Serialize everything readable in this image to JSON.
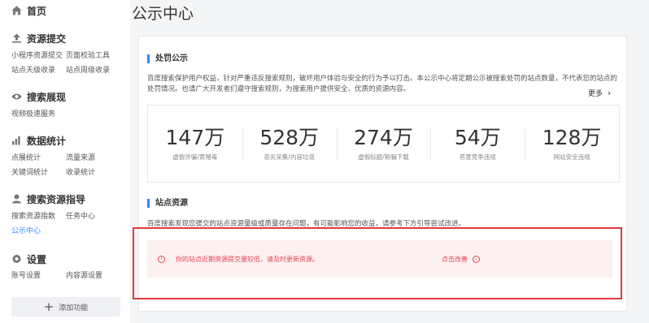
{
  "sidebar": {
    "home": "首页",
    "sections": [
      {
        "title": "资源提交",
        "icon": "upload-icon",
        "items": [
          "小程序资源提交",
          "页面校验工具",
          "站点天级收录",
          "站点周级收录"
        ]
      },
      {
        "title": "搜索展现",
        "icon": "eye-icon",
        "items": [
          "视频极速服务"
        ]
      },
      {
        "title": "数据统计",
        "icon": "bar-chart-icon",
        "items": [
          "点展统计",
          "流量来源",
          "关键词统计",
          "收录统计"
        ]
      },
      {
        "title": "搜索资源指导",
        "icon": "user-guide-icon",
        "items": [
          "搜索资源指数",
          "任务中心",
          "公示中心"
        ]
      },
      {
        "title": "设置",
        "icon": "gear-icon",
        "items": [
          "账号设置",
          "内容源设置"
        ]
      }
    ],
    "add_button": "添加功能"
  },
  "main": {
    "page_title": "公示中心",
    "punish": {
      "title": "处罚公示",
      "desc": "百度搜索保护用户权益，针对严重违反搜索规则，破坏用户体验与安全的行为予以打击。本公示中心将定期公示被搜索处罚的站点数量，不代表您的站点的处罚情况。也请广大开发者们遵守搜索规则，为搜索用户提供安全、优质的资源内容。",
      "more": "更多",
      "stats": [
        {
          "value": "147万",
          "label": "虚假诈骗/黄赌毒"
        },
        {
          "value": "528万",
          "label": "恶劣采集/内容垃圾"
        },
        {
          "value": "274万",
          "label": "虚假标题/欺骗下载"
        },
        {
          "value": "54万",
          "label": "恶意竞争违规"
        },
        {
          "value": "128万",
          "label": "网站安全违规"
        }
      ]
    },
    "site_resource": {
      "title": "站点资源",
      "desc": "百度搜索发现您提交的站点资源量级或质量存在问题，有可能影响您的收益，请参考下方引导尝试改进。",
      "alert_message": "你的站点近期资源提交量较低，请及时更新资源。",
      "alert_link": "点击改善"
    }
  },
  "colors": {
    "accent": "#3385ff",
    "alert_text": "#e64552",
    "alert_bg": "#fcf0f0",
    "highlight_border": "#e23b3b"
  }
}
